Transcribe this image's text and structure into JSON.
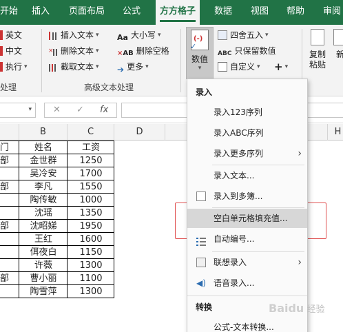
{
  "tabs": [
    "开始",
    "插入",
    "页面布局",
    "公式",
    "方方格子",
    "数据",
    "视图",
    "帮助",
    "审阅"
  ],
  "ribbon": {
    "left_items": [
      "英文",
      "中文",
      "执行"
    ],
    "left_group_label": "处理",
    "col2": [
      "插入文本",
      "删除文本",
      "截取文本"
    ],
    "col3": [
      "大小写",
      "删除空格",
      "更多"
    ],
    "group_label": "高级文本处理",
    "big_button": "数值",
    "col4": [
      "四舍五入",
      "只保留数值",
      "自定义"
    ],
    "plus_label": "+",
    "copy_paste": "复制粘贴",
    "cut_label": "新"
  },
  "formula_bar": {
    "cancel": "✕",
    "enter": "✓",
    "fx": "fx"
  },
  "grid": {
    "columns": [
      "",
      "B",
      "C",
      "D",
      "H"
    ],
    "col_a": [
      "门",
      "部",
      "",
      "部",
      "",
      "",
      "部",
      "",
      "",
      "",
      "部",
      ""
    ],
    "col_b": [
      "姓名",
      "金世群",
      "吴冷安",
      "李凡",
      "陶传敏",
      "沈瑶",
      "沈昭娣",
      "王红",
      "佴夜白",
      "许薇",
      "曹小丽",
      "陶雪萍"
    ],
    "col_c": [
      "工资",
      "1250",
      "1700",
      "1550",
      "1000",
      "1350",
      "1950",
      "1600",
      "1150",
      "1300",
      "1100",
      "1300"
    ]
  },
  "menu": {
    "section1": "录入",
    "items1": [
      "录入123序列",
      "录入ABC序列",
      "录入更多序列"
    ],
    "items2": [
      "录入文本...",
      "录入到多簿..."
    ],
    "highlight": "空白单元格填充值...",
    "items3": [
      "自动编号..."
    ],
    "items4": [
      "联想录入",
      "语音录入..."
    ],
    "section2": "转换",
    "items5": [
      "公式-文本转换..."
    ]
  },
  "watermark": {
    "brand": "Baidu",
    "text": "经验"
  }
}
